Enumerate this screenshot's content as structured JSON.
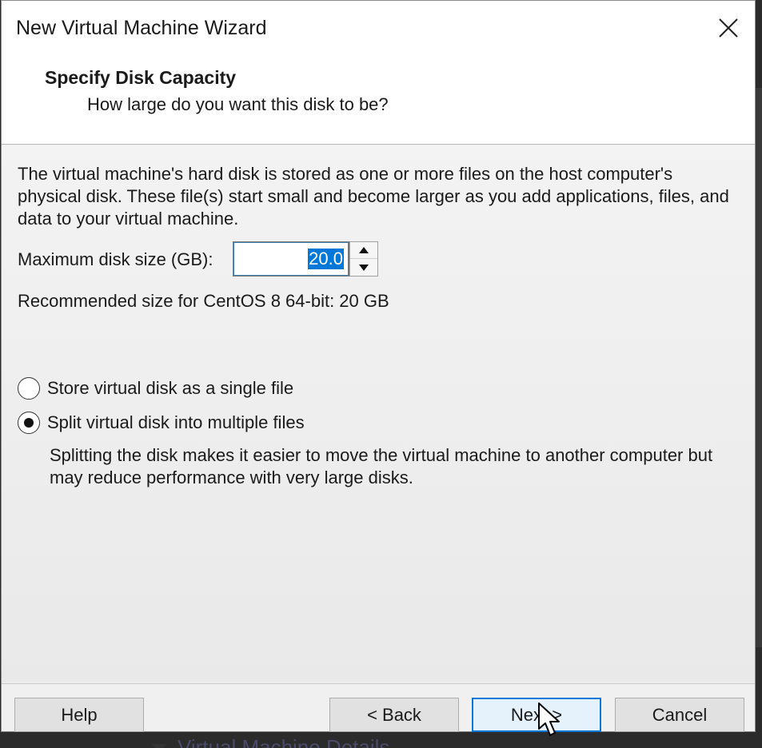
{
  "window": {
    "title": "New Virtual Machine Wizard"
  },
  "header": {
    "step_title": "Specify Disk Capacity",
    "step_subtitle": "How large do you want this disk to be?"
  },
  "content": {
    "description": "The virtual machine's hard disk is stored as one or more files on the host computer's physical disk. These file(s) start small and become larger as you add applications, files, and data to your virtual machine.",
    "max_size_label": "Maximum disk size (GB):",
    "max_size_value": "20.0",
    "recommended": "Recommended size for CentOS 8 64-bit: 20 GB",
    "options": [
      {
        "label": "Store virtual disk as a single file",
        "selected": false
      },
      {
        "label": "Split virtual disk into multiple files",
        "selected": true
      }
    ],
    "split_note": "Splitting the disk makes it easier to move the virtual machine to another computer but may reduce performance with very large disks."
  },
  "footer": {
    "help": "Help",
    "back": "< Back",
    "next": "Next >",
    "cancel": "Cancel"
  },
  "background": {
    "partial_text": "Virtual Machine Details"
  },
  "colors": {
    "accent": "#0078d7",
    "window_bg": "#f0f0f0",
    "header_bg": "#ffffff"
  },
  "icons": {
    "close": "close-icon",
    "spin_up": "triangle-up-icon",
    "spin_down": "triangle-down-icon",
    "cursor": "mouse-pointer-icon"
  }
}
